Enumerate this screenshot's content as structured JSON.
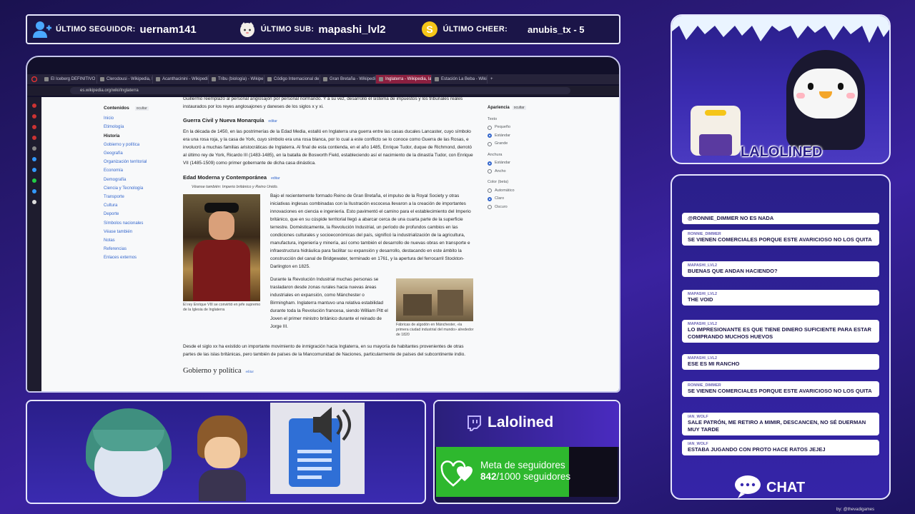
{
  "topbar": {
    "follower_label": "ÚLTIMO SEGUIDOR:",
    "follower_value": "uernam141",
    "sub_label": "ÚLTIMO SUB:",
    "sub_value": "mapashi_lvl2",
    "cheer_label": "ÚLTIMO CHEER:",
    "cheer_value": "anubis_tx - 5"
  },
  "browser": {
    "tabs": [
      "El Iceberg DEFINITIVO de",
      "Clerodousi - Wikipedia, la",
      "Acanthacinini - Wikipedia",
      "Tribu (biología) - Wikipe",
      "Código Internacional de",
      "Gran Bretaña - Wikipedia",
      "Inglaterra - Wikipedia, la",
      "Estación La Beba - Wikip"
    ],
    "active_tab": 6,
    "url": "es.wikipedia.org/wiki/Inglaterra"
  },
  "wiki": {
    "toc": {
      "title": "Contenidos",
      "hide": "ocultar",
      "items": [
        "Inicio",
        "Etimología",
        "Historia",
        "Gobierno y política",
        "Geografía",
        "Organización territorial",
        "Economía",
        "Demografía",
        "Ciencia y Tecnología",
        "Transporte",
        "Cultura",
        "Deporte",
        "Símbolos nacionales",
        "Véase también",
        "Notas",
        "Referencias",
        "Enlaces externos"
      ]
    },
    "intro_text": "Guillermo reemplazó al personal anglosajón por personal normando. Y a su vez, desarrolló el sistema de impuestos y los tribunales reales instaurados por los reyes anglosajones y daneses de los siglos x y xi.",
    "h_civil": "Guerra Civil y Nueva Monarquía",
    "edit": "editar",
    "p_civil": "En la década de 1450, en las postrimerías de la Edad Media, estalló en Inglaterra una guerra entre las casas ducales Lancaster, cuyo símbolo era una rosa roja, y la casa de York, cuyo símbolo era una rosa blanca, por lo cual a este conflicto se lo conoce como Guerra de las Rosas, e involucró a muchas familias aristocráticas de Inglaterra. Al final de esta contienda, en el año 1485, Enrique Tudor, duque de Richmond, derrotó al último rey de York, Ricardo III (1483-1485), en la batalla de Bosworth Field, estableciendo así el nacimiento de la dinastía Tudor, con Enrique VII (1485-1509) como primer gobernante de dicha casa dinástica.",
    "h_modern": "Edad Moderna y Contemporánea",
    "see_also": "Véanse también: Imperio británico y Reino Unido.",
    "p_modern": "Bajo el recientemente formado Reino de Gran Bretaña, el impulso de la Royal Society y otras iniciativas inglesas combinadas con la Ilustración escocesa llevaron a la creación de importantes innovaciones en ciencia e ingeniería. Esto pavimentó el camino para el establecimiento del Imperio británico, que en su cúspide territorial llegó a abarcar cerca de una cuarta parte de la superficie terrestre. Domésticamente, la Revolución Industrial, un período de profundos cambios en las condiciones culturales y socioeconómicas del país, significó la industrialización de la agricultura, manufactura, ingeniería y minería, así como también el desarrollo de nuevas obras en transporte e infraestructura hidráulica para facilitar su expansión y desarrollo, destacando en este ámbito la construcción del canal de Bridgewater, terminado en 1761, y la apertura del ferrocarril Stockton-Darlington en 1825.",
    "caption_henry": "El rey Enrique VIII se convirtió en jefe supremo de la Iglesia de Inglaterra",
    "p_rev": "Durante la Revolución Industrial muchas personas se trasladaron desde zonas rurales hacia nuevas áreas industriales en expansión, como Mánchester o Birmingham. Inglaterra mantuvo una relativa estabilidad durante toda la Revolución francesa, siendo William Pitt el Joven el primer ministro británico durante el reinado de Jorge III.",
    "caption_factory": "Fábricas de algodón en Mánchester, «la primera ciudad industrial del mundo» alrededor de 1820",
    "p_immig": "Desde el siglo xx ha existido un importante movimiento de inmigración hacia Inglaterra, en su mayoría de habitantes provenientes de otras partes de las islas británicas, pero también de países de la Mancomunidad de Naciones, particularmente de países del subcontinente indio.",
    "h_gov": "Gobierno y política",
    "appearance": {
      "title": "Apariencia",
      "hide": "ocultar",
      "text_label": "Texto",
      "text_opts": [
        "Pequeño",
        "Estándar",
        "Grande"
      ],
      "width_label": "Anchura",
      "width_opts": [
        "Estándar",
        "Ancho"
      ],
      "color_label": "Color (beta)",
      "color_opts": [
        "Automático",
        "Claro",
        "Oscuro"
      ]
    }
  },
  "webcam": {
    "name": "LALOLINED"
  },
  "chat": {
    "label": "CHAT",
    "messages": [
      {
        "user": "",
        "text": "@RONNIE_DIMMER NO ES NADA"
      },
      {
        "user": "RONNIE_DIMMER",
        "text": "SE VIENEN COMERCIALES PORQUE ESTE AVARICIOSO NO LOS QUITA"
      },
      {
        "user": "MAPASHI_LVL2",
        "text": "BUENAS QUE ANDAN HACIENDO?"
      },
      {
        "user": "MAPASHI_LVL2",
        "text": "THE VOID"
      },
      {
        "user": "MAPASHI_LVL2",
        "text": "LO IMPRESIONANTE ES QUE TIENE DINERO SUFICIENTE PARA ESTAR COMPRANDO MUCHOS HUEVOS"
      },
      {
        "user": "MAPASHI_LVL2",
        "text": "ESE ES MI RANCHO"
      },
      {
        "user": "RONNIE_DIMMER",
        "text": "SE VIENEN COMERCIALES PORQUE ESTE AVARICIOSO NO LOS QUITA"
      },
      {
        "user": "IAN_WOLF",
        "text": "SALE PATRÓN, ME RETIRO A MIMIR, DESCANCEN, NO SÉ DUERMAN MUY TARDE"
      },
      {
        "user": "IAN_WOLF",
        "text": "ESTABA JUGANDO CON PROTO HACE RATOS JEJEJ"
      }
    ]
  },
  "goal": {
    "channel": "Lalolined",
    "title": "Meta de seguidores",
    "current": "842",
    "target": "/1000 seguidores",
    "fraction": 0.842
  },
  "credit": "by: @thevadigames",
  "colors": {
    "accent": "#3a2bb0",
    "goal_green": "#2eb82e",
    "wiki_link": "#3366cc"
  }
}
